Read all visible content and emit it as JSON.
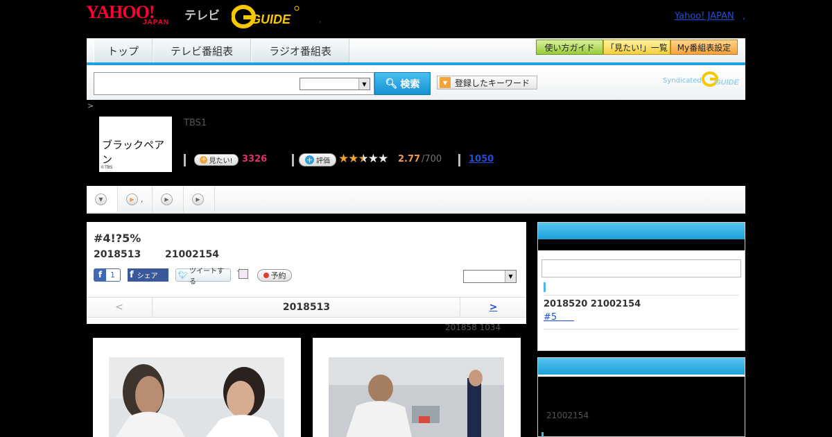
{
  "header": {
    "logo_yahoo": "YAHOO!",
    "logo_japan": "JAPAN",
    "logo_tv": "テレビ",
    "logo_gguide": "G-GUIDE",
    "yahoo_japan_link": "Yahoo! JAPAN",
    "dot": ",",
    "small_dot": ","
  },
  "nav": {
    "tabs": [
      "トップ",
      "テレビ番組表",
      "ラジオ番組表"
    ],
    "guide_buttons": [
      "使い方ガイド",
      "「見たい!」一覧",
      "My番組表設定"
    ]
  },
  "search": {
    "input_value": "",
    "select_value": "",
    "button_label": "検索",
    "keyword_button": "登録したキーワード",
    "syndicated": "Syndicated"
  },
  "breadcrumb": ">",
  "program": {
    "thumb_title": "ブラックペアン",
    "thumb_credit": "©TBS",
    "channel": "TBS1",
    "mitai_label": "見たい!",
    "mitai_count": "3326",
    "hyoka_label": "評価",
    "rating": 2.77,
    "rating_text": "2.77",
    "rating_max": "/700",
    "reviews": "1050"
  },
  "subtabs": [
    ",",
    "",
    ""
  ],
  "episode": {
    "title": "#4!?5%",
    "date": "2018513",
    "time": "21002154",
    "fb_like_count": "1",
    "fb_share": "シェア",
    "tweet": "ツイートする",
    "reserve": "予約",
    "select_value": "",
    "prev": "<",
    "current": "2018513",
    "next": ">",
    "updated": "201858  1034"
  },
  "sidebar": {
    "next_date": "2018520  21002154",
    "next_link": "#5      ",
    "time2": "21002154"
  },
  "colors": {
    "accent_blue": "#1ea0dc",
    "mitai_pink": "#e0306f",
    "rating_orange": "#f39c45",
    "link_blue": "#1f4fd8"
  }
}
